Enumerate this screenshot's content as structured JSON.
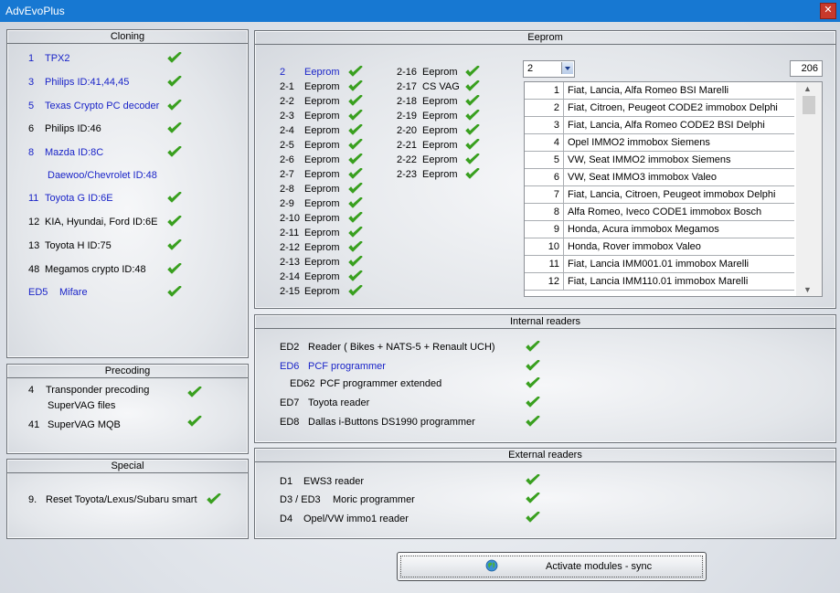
{
  "window": {
    "title": "AdvEvoPlus",
    "close_glyph": "✕"
  },
  "colors": {
    "titlebar": "#1778d2",
    "blue_text": "#1a24c8",
    "check_green": "#3aa020"
  },
  "cloning": {
    "title": "Cloning",
    "items": [
      {
        "id": "1",
        "label": "TPX2",
        "blue": true,
        "checked": true
      },
      {
        "id": "3",
        "label": "Philips ID:41,44,45",
        "blue": true,
        "checked": true
      },
      {
        "id": "5",
        "label": "Texas Crypto PC decoder",
        "blue": true,
        "checked": true
      },
      {
        "id": "6",
        "label": "Philips ID:46",
        "blue": false,
        "checked": true
      },
      {
        "id": "8",
        "label": "Mazda ID:8C",
        "blue": true,
        "checked": true
      },
      {
        "id": "",
        "label": "Daewoo/Chevrolet ID:48",
        "blue": true,
        "checked": false
      },
      {
        "id": "11",
        "label": "Toyota G ID:6E",
        "blue": true,
        "checked": true
      },
      {
        "id": "12",
        "label": "KIA, Hyundai, Ford ID:6E",
        "blue": false,
        "checked": true
      },
      {
        "id": "13",
        "label": "Toyota H ID:75",
        "blue": false,
        "checked": true
      },
      {
        "id": "48",
        "label": "Megamos crypto ID:48",
        "blue": false,
        "checked": true
      },
      {
        "id": "ED5",
        "label": "Mifare",
        "blue": true,
        "checked": true
      }
    ]
  },
  "precoding": {
    "title": "Precoding",
    "items": [
      {
        "id": "4",
        "label": "Transponder precoding",
        "label2": "SuperVAG files",
        "checked": true
      },
      {
        "id": "41",
        "label": "SuperVAG MQB",
        "checked": true
      }
    ]
  },
  "special": {
    "title": "Special",
    "items": [
      {
        "id": "9.",
        "label": "Reset Toyota/Lexus/Subaru smart",
        "checked": true
      }
    ]
  },
  "eeprom": {
    "title": "Eeprom",
    "col1": [
      {
        "id": "2",
        "label": "Eeprom",
        "blue": true
      },
      {
        "id": "2-1",
        "label": "Eeprom"
      },
      {
        "id": "2-2",
        "label": "Eeprom"
      },
      {
        "id": "2-3",
        "label": "Eeprom"
      },
      {
        "id": "2-4",
        "label": "Eeprom"
      },
      {
        "id": "2-5",
        "label": "Eeprom"
      },
      {
        "id": "2-6",
        "label": "Eeprom"
      },
      {
        "id": "2-7",
        "label": "Eeprom"
      },
      {
        "id": "2-8",
        "label": "Eeprom"
      },
      {
        "id": "2-9",
        "label": "Eeprom"
      },
      {
        "id": "2-10",
        "label": "Eeprom"
      },
      {
        "id": "2-11",
        "label": "Eeprom"
      },
      {
        "id": "2-12",
        "label": "Eeprom"
      },
      {
        "id": "2-13",
        "label": "Eeprom"
      },
      {
        "id": "2-14",
        "label": "Eeprom"
      },
      {
        "id": "2-15",
        "label": "Eeprom"
      }
    ],
    "col2": [
      {
        "id": "2-16",
        "label": "Eeprom"
      },
      {
        "id": "2-17",
        "label": "CS VAG"
      },
      {
        "id": "2-18",
        "label": "Eeprom"
      },
      {
        "id": "2-19",
        "label": "Eeprom"
      },
      {
        "id": "2-20",
        "label": "Eeprom"
      },
      {
        "id": "2-21",
        "label": "Eeprom"
      },
      {
        "id": "2-22",
        "label": "Eeprom"
      },
      {
        "id": "2-23",
        "label": "Eeprom"
      }
    ],
    "selected": "2",
    "count": "206",
    "list": [
      {
        "n": "1",
        "text": "Fiat, Lancia, Alfa Romeo BSI Marelli"
      },
      {
        "n": "2",
        "text": "Fiat, Citroen, Peugeot CODE2 immobox Delphi"
      },
      {
        "n": "3",
        "text": "Fiat, Lancia, Alfa Romeo CODE2 BSI Delphi"
      },
      {
        "n": "4",
        "text": "Opel IMMO2 immobox Siemens"
      },
      {
        "n": "5",
        "text": "VW, Seat IMMO2 immobox Siemens"
      },
      {
        "n": "6",
        "text": "VW, Seat IMMO3 immobox Valeo"
      },
      {
        "n": "7",
        "text": "Fiat, Lancia, Citroen, Peugeot immobox Delphi"
      },
      {
        "n": "8",
        "text": "Alfa Romeo, Iveco CODE1 immobox Bosch"
      },
      {
        "n": "9",
        "text": "Honda, Acura immobox Megamos"
      },
      {
        "n": "10",
        "text": "Honda, Rover immobox Valeo"
      },
      {
        "n": "11",
        "text": "Fiat, Lancia IMM001.01 immobox Marelli"
      },
      {
        "n": "12",
        "text": "Fiat, Lancia IMM110.01 immobox Marelli"
      }
    ]
  },
  "internal": {
    "title": "Internal readers",
    "items": [
      {
        "id": "ED2",
        "label": "Reader  ( Bikes + NATS-5 + Renault UCH)",
        "blue": false
      },
      {
        "id": "ED6",
        "label": "PCF programmer",
        "blue": true
      },
      {
        "id": "ED62",
        "label": "PCF programmer extended",
        "blue": false
      },
      {
        "id": "ED7",
        "label": "Toyota reader",
        "blue": false
      },
      {
        "id": "ED8",
        "label": "Dallas i-Buttons DS1990 programmer",
        "blue": false
      }
    ]
  },
  "external": {
    "title": "External readers",
    "items": [
      {
        "id": "D1",
        "label": "EWS3 reader"
      },
      {
        "id": "D3 / ED3",
        "label": "Moric programmer"
      },
      {
        "id": "D4",
        "label": "Opel/VW immo1 reader"
      }
    ]
  },
  "activate": {
    "label": "Activate modules - sync",
    "icon": "globe-icon"
  }
}
